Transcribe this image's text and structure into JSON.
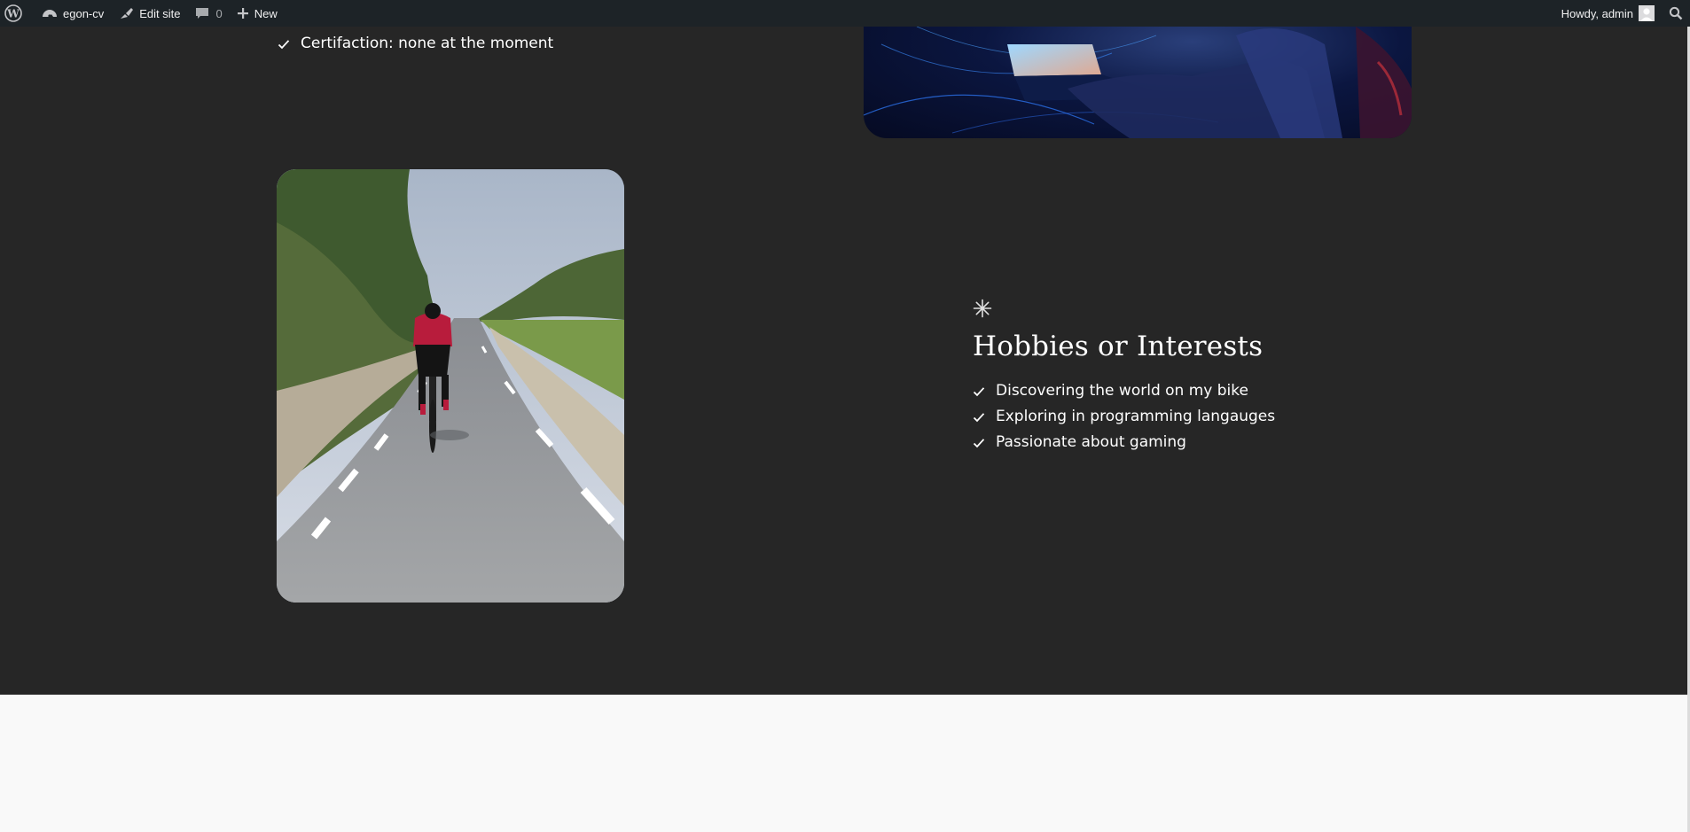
{
  "adminbar": {
    "site_name": "egon-cv",
    "edit_site": "Edit site",
    "comments_count": "0",
    "new_label": "New",
    "howdy": "Howdy, admin",
    "icons": {
      "logo": "wordpress-logo-icon",
      "site": "dashboard-icon",
      "edit": "brush-icon",
      "comments": "comment-bubble-icon",
      "new": "plus-icon",
      "avatar": "avatar-icon",
      "search": "search-icon"
    }
  },
  "previous_section": {
    "certification": "Certifaction: none at the moment"
  },
  "hobbies": {
    "title": "Hobbies or Interests",
    "items": [
      "Discovering the world on my bike",
      "Exploring in programming langauges",
      "Passionate about gaming"
    ]
  },
  "colors": {
    "dark_bg": "#262626",
    "admin_bar": "#1d2327",
    "page_bg": "#f9f9f9",
    "text": "#ffffff"
  }
}
